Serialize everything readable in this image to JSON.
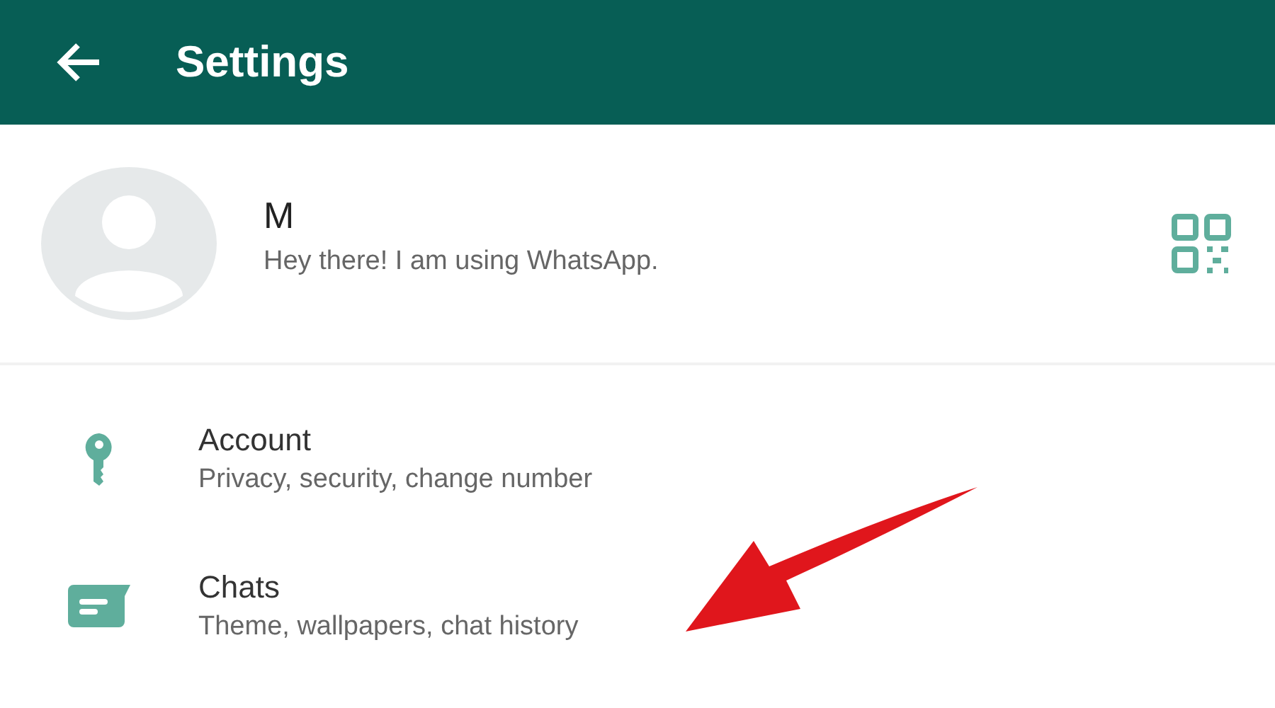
{
  "header": {
    "title": "Settings"
  },
  "profile": {
    "name": "M",
    "status": "Hey there! I am using WhatsApp."
  },
  "items": [
    {
      "kind": "account",
      "title": "Account",
      "subtitle": "Privacy, security, change number"
    },
    {
      "kind": "chats",
      "title": "Chats",
      "subtitle": "Theme, wallpapers, chat history"
    }
  ]
}
